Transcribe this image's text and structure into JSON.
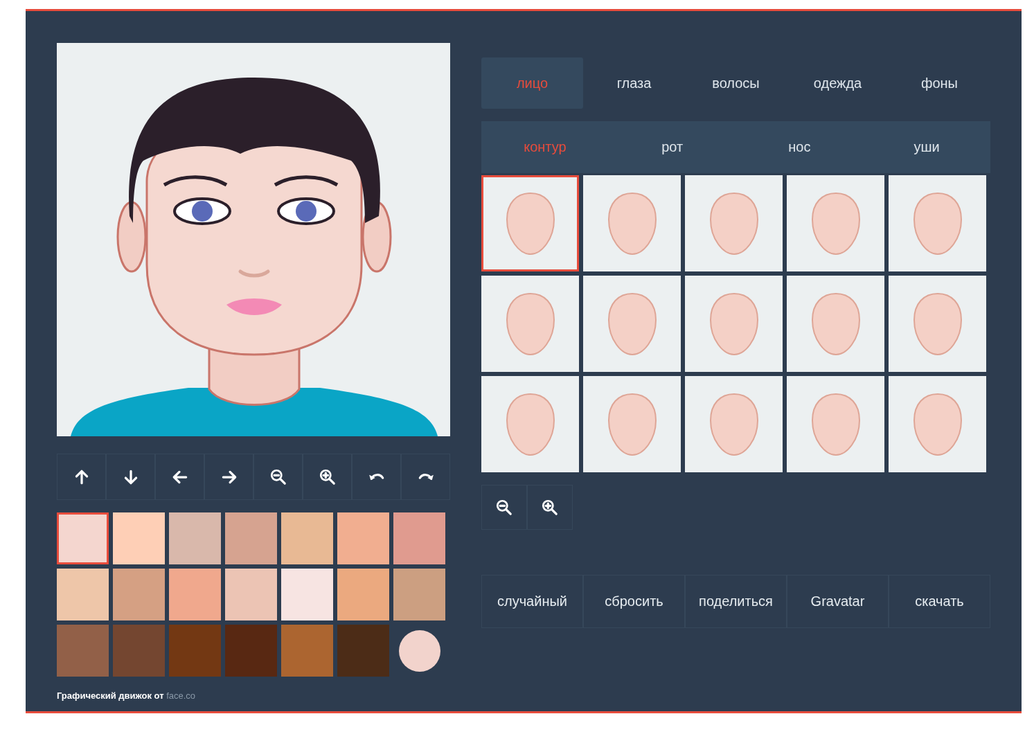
{
  "tabs": [
    {
      "label": "лицо",
      "selected": true
    },
    {
      "label": "глаза",
      "selected": false
    },
    {
      "label": "волосы",
      "selected": false
    },
    {
      "label": "одежда",
      "selected": false
    },
    {
      "label": "фоны",
      "selected": false
    }
  ],
  "subtabs": [
    {
      "label": "контур",
      "selected": true
    },
    {
      "label": "рот",
      "selected": false
    },
    {
      "label": "нос",
      "selected": false
    },
    {
      "label": "уши",
      "selected": false
    }
  ],
  "face_shapes": [
    {
      "selected": true
    },
    {
      "selected": false
    },
    {
      "selected": false
    },
    {
      "selected": false
    },
    {
      "selected": false
    },
    {
      "selected": false
    },
    {
      "selected": false
    },
    {
      "selected": false
    },
    {
      "selected": false
    },
    {
      "selected": false
    },
    {
      "selected": false
    },
    {
      "selected": false
    },
    {
      "selected": false
    },
    {
      "selected": false
    },
    {
      "selected": false
    }
  ],
  "toolbar": [
    {
      "kind": "up"
    },
    {
      "kind": "down"
    },
    {
      "kind": "left"
    },
    {
      "kind": "right"
    },
    {
      "kind": "zoom-out"
    },
    {
      "kind": "zoom-in"
    },
    {
      "kind": "undo"
    },
    {
      "kind": "redo"
    }
  ],
  "shape_zoom": [
    {
      "kind": "zoom-out"
    },
    {
      "kind": "zoom-in"
    }
  ],
  "swatches": [
    {
      "color": "#f4d6cf",
      "selected": true
    },
    {
      "color": "#fecfb6",
      "selected": false
    },
    {
      "color": "#d9b8ab",
      "selected": false
    },
    {
      "color": "#d6a390",
      "selected": false
    },
    {
      "color": "#e8b994",
      "selected": false
    },
    {
      "color": "#f1ae90",
      "selected": false
    },
    {
      "color": "#e09b8f",
      "selected": false
    },
    {
      "color": "#eec6a9",
      "selected": false
    },
    {
      "color": "#d5a083",
      "selected": false
    },
    {
      "color": "#f0a88d",
      "selected": false
    },
    {
      "color": "#ecc4b4",
      "selected": false
    },
    {
      "color": "#f7e4e2",
      "selected": false
    },
    {
      "color": "#eba97f",
      "selected": false
    },
    {
      "color": "#cc9f81",
      "selected": false
    },
    {
      "color": "#926048",
      "selected": false
    },
    {
      "color": "#744630",
      "selected": false
    },
    {
      "color": "#733813",
      "selected": false
    },
    {
      "color": "#582812",
      "selected": false
    },
    {
      "color": "#ac6530",
      "selected": false
    },
    {
      "color": "#4c2c17",
      "selected": false
    }
  ],
  "custom_color": {
    "color": "#f2d3cc"
  },
  "actions": [
    "случайный",
    "сбросить",
    "поделиться",
    "Gravatar",
    "скачать"
  ],
  "footer": {
    "text": "Графический движок от",
    "link": "face.co"
  }
}
